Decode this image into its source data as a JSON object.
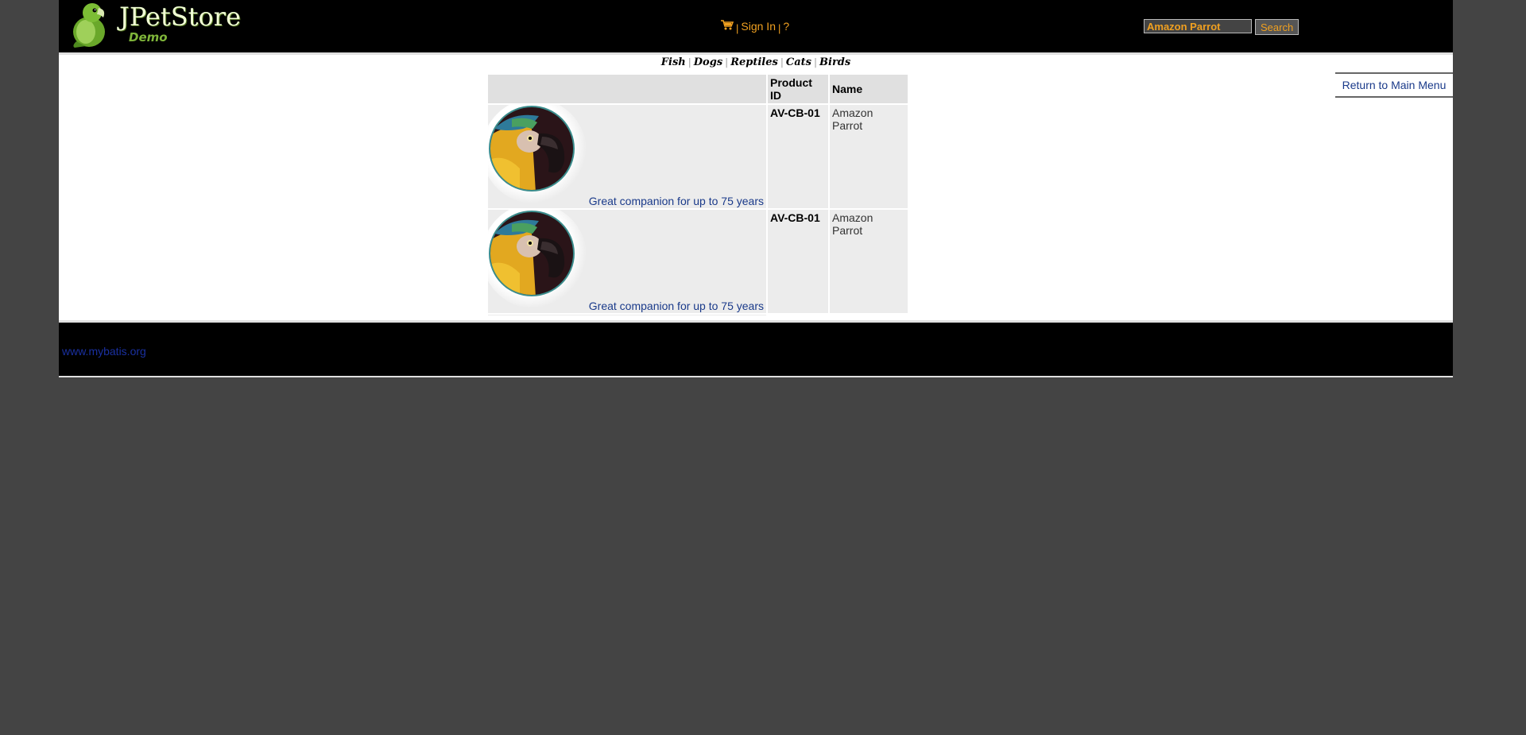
{
  "header": {
    "brand_title": "JPetStore",
    "brand_subtitle": "Demo",
    "cart_icon": "cart-icon",
    "sign_in_label": "Sign In",
    "help_label": "?",
    "separator": "|",
    "search": {
      "value": "Amazon Parrot",
      "button_label": "Search"
    }
  },
  "quicklinks": [
    "Fish",
    "Dogs",
    "Reptiles",
    "Cats",
    "Birds"
  ],
  "back_link": "Return to Main Menu",
  "table": {
    "columns": [
      "",
      "Product ID",
      "Name"
    ],
    "rows": [
      {
        "image": "amazon-parrot-image",
        "description": "Great companion for up to 75 years",
        "product_id": "AV-CB-01",
        "name": "Amazon Parrot"
      },
      {
        "image": "amazon-parrot-image",
        "description": "Great companion for up to 75 years",
        "product_id": "AV-CB-01",
        "name": "Amazon Parrot"
      }
    ]
  },
  "footer": {
    "link": "www.mybatis.org"
  },
  "colors": {
    "page_background": "#444444",
    "header_background": "#000000",
    "accent_orange": "#f0a020",
    "link_blue": "#1a3a8a"
  }
}
